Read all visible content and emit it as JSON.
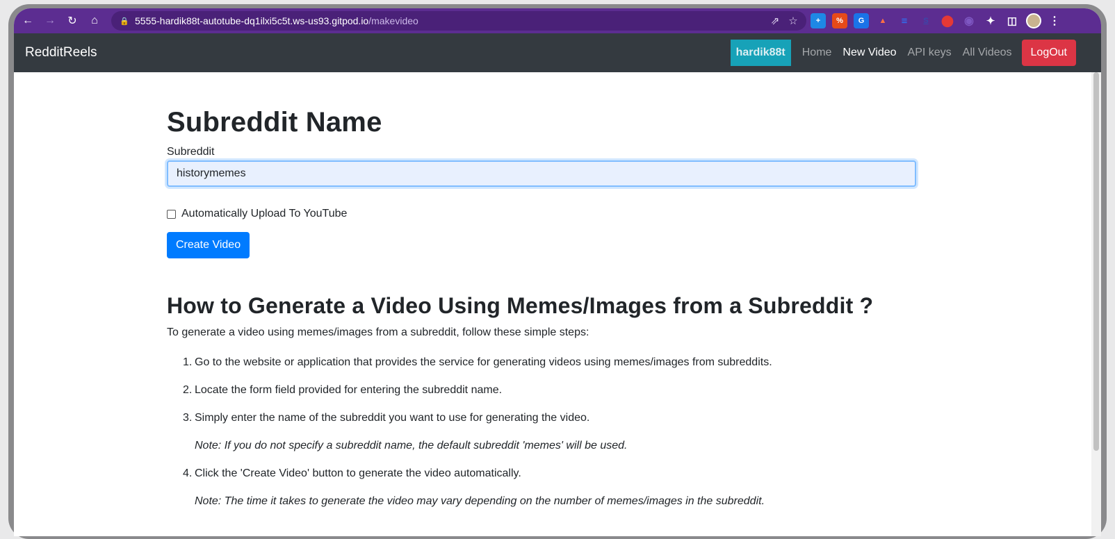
{
  "browser": {
    "url_host": "5555-hardik88t-autotube-dq1ilxi5c5t.ws-us93.gitpod.io",
    "url_path": "/makevideo",
    "icons": [
      "back-icon",
      "forward-icon",
      "reload-icon",
      "home-icon",
      "lock-icon",
      "share-icon",
      "star-icon",
      "extensions-icon",
      "sidepanel-icon",
      "menu-icon"
    ],
    "extensions": [
      {
        "name": "plus-extension",
        "color": "#1e88e5",
        "glyph": "+"
      },
      {
        "name": "percent-extension",
        "color": "#e64a19",
        "glyph": "%"
      },
      {
        "name": "translate-extension",
        "color": "#1a73e8",
        "glyph": "G"
      },
      {
        "name": "bird-extension",
        "color": "#ff7043",
        "glyph": "▲"
      },
      {
        "name": "lines-extension",
        "color": "#2979ff",
        "glyph": "≡"
      },
      {
        "name": "s-extension",
        "color": "#3949ab",
        "glyph": "S"
      },
      {
        "name": "shield-extension",
        "color": "#d50000",
        "glyph": "●"
      },
      {
        "name": "brain-extension",
        "color": "#7e57c2",
        "glyph": "◉"
      }
    ]
  },
  "nav": {
    "brand": "RedditReels",
    "username": "hardik88t",
    "links": [
      "Home",
      "New Video",
      "API keys",
      "All Videos"
    ],
    "active": "New Video",
    "logout": "LogOut"
  },
  "form": {
    "title": "Subreddit Name",
    "label": "Subreddit",
    "value": "historymemes",
    "checkbox_label": "Automatically Upload To YouTube",
    "checkbox_checked": false,
    "submit": "Create Video"
  },
  "help": {
    "heading": "How to Generate a Video Using Memes/Images from a Subreddit ?",
    "intro": "To generate a video using memes/images from a subreddit, follow these simple steps:",
    "steps": [
      {
        "num": "1.",
        "text": "Go to the website or application that provides the service for generating videos using memes/images from subreddits."
      },
      {
        "num": "2.",
        "text": "Locate the form field provided for entering the subreddit name."
      },
      {
        "num": "3.",
        "text": "Simply enter the name of the subreddit you want to use for generating the video.",
        "note": "Note: If you do not specify a subreddit name, the default subreddit 'memes' will be used."
      },
      {
        "num": "4.",
        "text": "Click the 'Create Video' button to generate the video automatically.",
        "note": "Note: The time it takes to generate the video may vary depending on the number of memes/images in the subreddit."
      }
    ]
  },
  "colors": {
    "browser_bar": "#5c2d91",
    "navbar": "#343a40",
    "user_badge": "#17a2b8",
    "logout": "#dc3545",
    "primary": "#007bff"
  }
}
